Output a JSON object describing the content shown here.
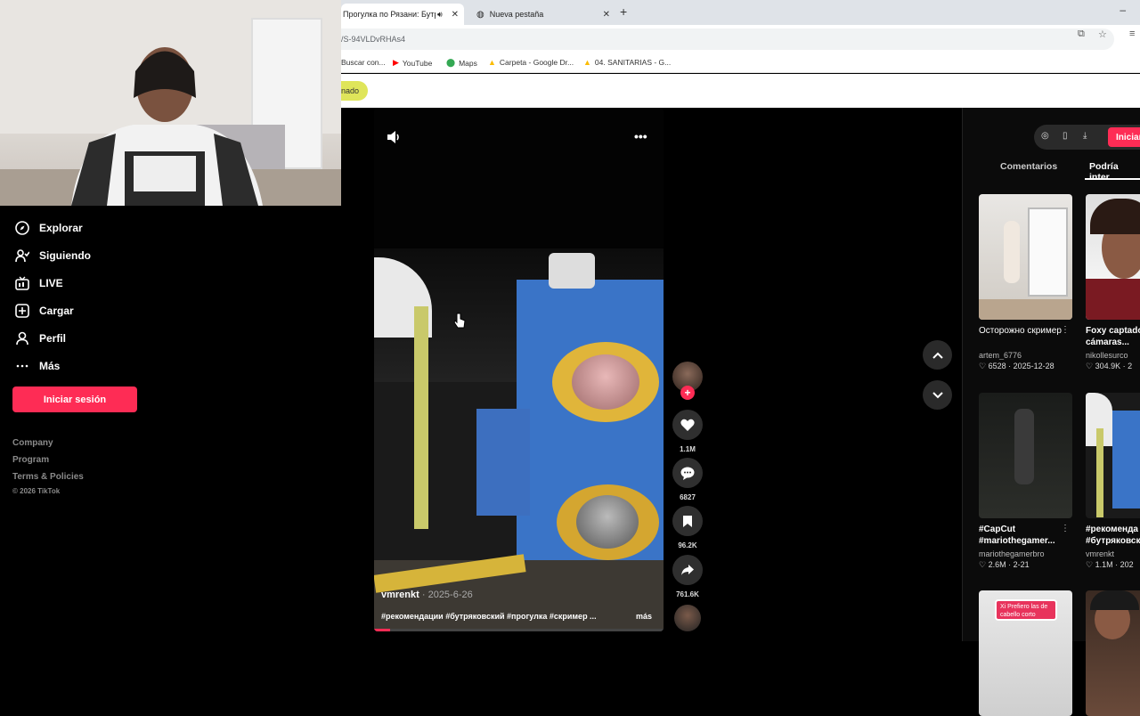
{
  "browser": {
    "active_tab_title": "Прогулка по Рязани: Бутр",
    "active_tab_audio_icon": "speaker-icon",
    "inactive_tab_title": "Nueva pestaña",
    "close_glyph": "✕",
    "new_tab_glyph": "+",
    "url": "/S-94VLDvRHAs4",
    "bookmarks": [
      {
        "label": "Buscar con...",
        "icon": "google-icon"
      },
      {
        "label": "YouTube",
        "icon": "youtube-icon"
      },
      {
        "label": "Maps",
        "icon": "maps-icon"
      },
      {
        "label": "Carpeta - Google Dr...",
        "icon": "drive-icon"
      },
      {
        "label": "04. SANITARIAS - G...",
        "icon": "drive-icon"
      }
    ],
    "page_pill_text": "nado"
  },
  "sidebar": {
    "items": [
      {
        "label": "Explorar",
        "icon": "compass-icon"
      },
      {
        "label": "Siguiendo",
        "icon": "user-follow-icon"
      },
      {
        "label": "LIVE",
        "icon": "live-tv-icon"
      },
      {
        "label": "Cargar",
        "icon": "upload-plus-icon"
      },
      {
        "label": "Perfil",
        "icon": "profile-icon"
      },
      {
        "label": "Más",
        "icon": "more-dots-icon"
      }
    ],
    "login_button": "Iniciar sesión",
    "footer_links": [
      "Company",
      "Program",
      "Terms & Policies"
    ],
    "copyright": "© 2026 TikTok"
  },
  "video": {
    "author": "vmrenkt",
    "date": "· 2025-6-26",
    "hashtags": "#рекомендации #бутряковский #прогулка #скример ...",
    "more_label": "más",
    "progress_fraction": 0.055
  },
  "actions": {
    "likes": "1.1M",
    "comments": "6827",
    "saves": "96.2K",
    "shares": "761.6K",
    "follow_glyph": "+"
  },
  "right_panel": {
    "login_button": "Iniciar",
    "tab_comments": "Comentarios",
    "tab_related": "Podría inter",
    "cards": [
      {
        "title": "Осторожно скример",
        "author": "artem_6776",
        "stats": "♡ 6528 · 2025-12-28"
      },
      {
        "title": "Foxy captado cámaras...",
        "author": "nikollesurco",
        "stats": "♡ 304.9K · 2"
      },
      {
        "title": "#CapCut #mariothegamer...",
        "author": "mariothegamerbro",
        "stats": "♡ 2.6M · 2-21"
      },
      {
        "title": "#рекоменда #бутряковск",
        "author": "vmrenkt",
        "stats": "♡ 1.1M · 202"
      }
    ],
    "bottom_card_badge": "Xi Prefiero las de cabello corto"
  },
  "colors": {
    "accent": "#fe2c55",
    "background": "#000000",
    "pill": "#dfe55a"
  }
}
